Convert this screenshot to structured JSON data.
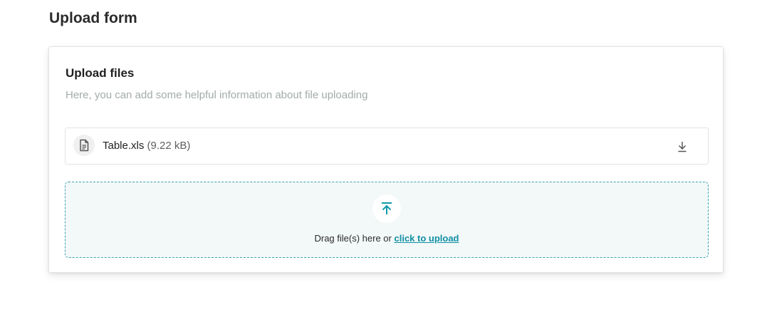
{
  "page": {
    "title": "Upload form"
  },
  "card": {
    "title": "Upload files",
    "description": "Here, you can add some helpful information about file uploading"
  },
  "file": {
    "icon": "document-icon",
    "name": "Table.xls",
    "size": "(9.22 kB)",
    "download_icon": "download-icon"
  },
  "dropzone": {
    "icon": "upload-arrow-icon",
    "text": "Drag file(s) here or",
    "link": "click to upload"
  },
  "colors": {
    "accent": "#0f8fa3",
    "dropzone_border": "#39a3b5",
    "dropzone_bg": "#f3f8f8",
    "muted_text": "#a3abab"
  }
}
